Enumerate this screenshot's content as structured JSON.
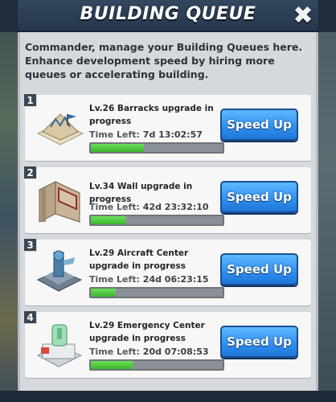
{
  "header": {
    "title": "BUILDING QUEUE",
    "close_symbol": "✖"
  },
  "description": "Commander, manage your Building Queues here. Enhance development speed by hiring more queues or accelerating building.",
  "queues": [
    {
      "index": "1",
      "name": "Lv.26 Barracks upgrade in progress",
      "time_label": "Time Left:",
      "time_value": "7d 13:02:57",
      "progress": 0.4,
      "button": "Speed Up",
      "icon": "barracks-icon"
    },
    {
      "index": "2",
      "name": "Lv.34 Wall upgrade in progress",
      "time_label": "Time Left:",
      "time_value": "42d 23:32:10",
      "progress": 0.27,
      "button": "Speed Up",
      "icon": "wall-icon"
    },
    {
      "index": "3",
      "name": "Lv.29 Aircraft Center upgrade in progress",
      "time_label": "Time Left:",
      "time_value": "24d 06:23:15",
      "progress": 0.19,
      "button": "Speed Up",
      "icon": "aircraft-center-icon"
    },
    {
      "index": "4",
      "name": "Lv.29 Emergency Center upgrade in progress",
      "time_label": "Time Left:",
      "time_value": "20d 07:08:53",
      "progress": 0.32,
      "button": "Speed Up",
      "icon": "emergency-center-icon"
    }
  ],
  "colors": {
    "accent_button": "#2d8ef0",
    "progress_fill": "#3ab62c",
    "header": "#26374d"
  }
}
